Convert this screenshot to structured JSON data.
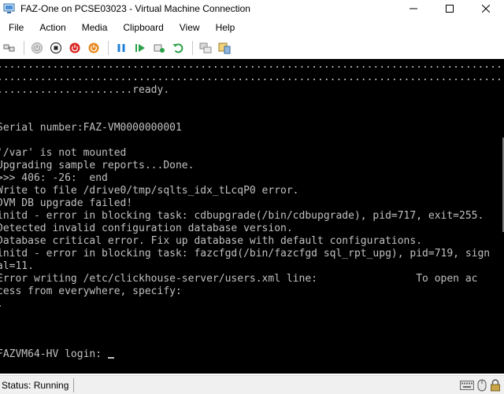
{
  "window": {
    "title": "FAZ-One on PCSE03023 - Virtual Machine Connection",
    "minimize_icon": "minimize-icon",
    "maximize_icon": "maximize-icon",
    "close_icon": "close-icon"
  },
  "menu": [
    {
      "label": "File"
    },
    {
      "label": "Action"
    },
    {
      "label": "Media"
    },
    {
      "label": "Clipboard"
    },
    {
      "label": "View"
    },
    {
      "label": "Help"
    }
  ],
  "toolbar": [
    {
      "icon": "ctrl-alt-del-icon"
    },
    {
      "icon": "start-icon"
    },
    {
      "icon": "turn-off-icon"
    },
    {
      "icon": "shut-down-icon"
    },
    {
      "icon": "power-icon"
    },
    {
      "icon": "pause-icon"
    },
    {
      "icon": "resume-icon"
    },
    {
      "icon": "checkpoint-icon"
    },
    {
      "icon": "revert-icon"
    },
    {
      "icon": "enhanced-session-icon"
    },
    {
      "icon": "share-icon"
    }
  ],
  "console": {
    "lines": [
      "......................................................................................",
      "......................................................................................",
      "......................ready.",
      "",
      "",
      "Serial number:FAZ-VM0000000001",
      "",
      "'/var' is not mounted",
      "Upgrading sample reports...Done.",
      ">>> 406: -26:  end",
      "Write to file /drive0/tmp/sqlts_idx_tLcqP0 error.",
      "DVM DB upgrade failed!",
      "initd - error in blocking task: cdbupgrade(/bin/cdbupgrade), pid=717, exit=255.",
      "Detected invalid configuration database version.",
      "Database critical error. Fix up database with default configurations.",
      "initd - error in blocking task: fazcfgd(/bin/fazcfgd sql_rpt_upg), pid=719, sign",
      "al=11.",
      "Error writing /etc/clickhouse-server/users.xml line:                To open ac",
      "cess from everywhere, specify:",
      ".",
      "",
      "",
      "",
      "FAZVM64-HV login: "
    ]
  },
  "status": {
    "text": "Status: Running"
  },
  "colors": {
    "console_bg": "#000000",
    "console_fg": "#c0c0c0",
    "accent_red": "#d9231f",
    "accent_orange": "#e8891e",
    "accent_blue": "#1e7fd6",
    "accent_green": "#2aa14a"
  }
}
